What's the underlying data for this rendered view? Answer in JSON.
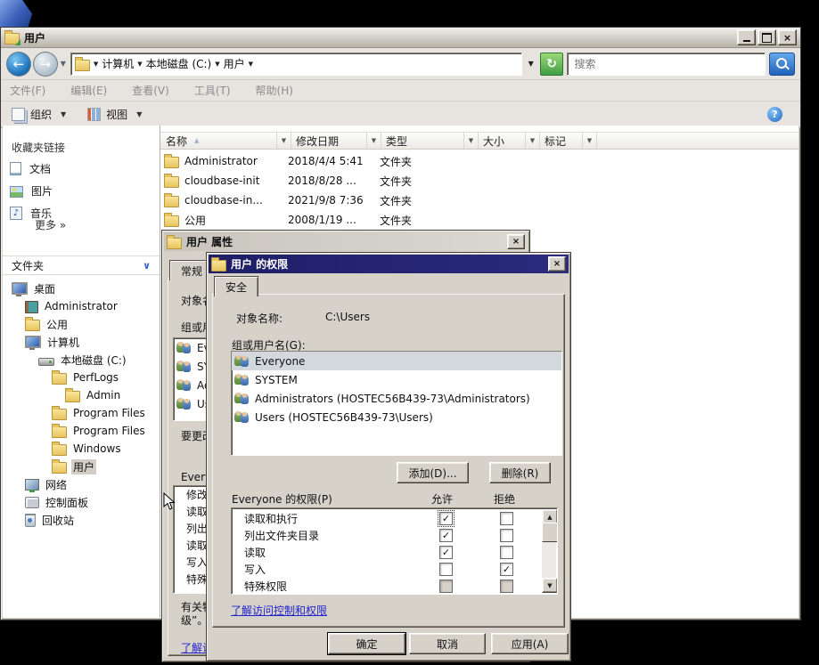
{
  "explorer": {
    "title": "用户",
    "breadcrumbs": [
      "计算机",
      "本地磁盘 (C:)",
      "用户"
    ],
    "search_placeholder": "搜索",
    "menu_items": [
      "文件(F)",
      "编辑(E)",
      "查看(V)",
      "工具(T)",
      "帮助(H)"
    ],
    "toolbar": {
      "organize": "组织",
      "views": "视图"
    },
    "sidebar": {
      "favorites_header": "收藏夹链接",
      "favorites": [
        {
          "label": "文档"
        },
        {
          "label": "图片"
        },
        {
          "label": "音乐"
        }
      ],
      "more_link": "更多  »",
      "folders_header": "文件夹",
      "tree": [
        {
          "label": "桌面",
          "level": 0
        },
        {
          "label": "Administrator",
          "level": 1
        },
        {
          "label": "公用",
          "level": 1
        },
        {
          "label": "计算机",
          "level": 1
        },
        {
          "label": "本地磁盘 (C:)",
          "level": 2
        },
        {
          "label": "PerfLogs",
          "level": 3
        },
        {
          "label": "Admin",
          "level": 4
        },
        {
          "label": "Program Files",
          "level": 3
        },
        {
          "label": "Program Files",
          "level": 3
        },
        {
          "label": "Windows",
          "level": 3
        },
        {
          "label": "用户",
          "level": 3,
          "selected": true
        },
        {
          "label": "网络",
          "level": 1
        },
        {
          "label": "控制面板",
          "level": 1
        },
        {
          "label": "回收站",
          "level": 1
        }
      ]
    },
    "filelist": {
      "columns": [
        "名称",
        "修改日期",
        "类型",
        "大小",
        "标记"
      ],
      "rows": [
        {
          "name": "Administrator",
          "date": "2018/4/4 5:41",
          "type": "文件夹"
        },
        {
          "name": "cloudbase-init",
          "date": "2018/8/28 ...",
          "type": "文件夹"
        },
        {
          "name": "cloudbase-in...",
          "date": "2021/9/8 7:36",
          "type": "文件夹"
        },
        {
          "name": "公用",
          "date": "2008/1/19 ...",
          "type": "文件夹"
        }
      ]
    }
  },
  "props_dialog": {
    "title": "用户 属性",
    "tab": "常规",
    "object_label": "对象名称:",
    "groups_label": "组或用户名(G):",
    "edit_hint": "要更改权限,请单击“编辑”(E)。",
    "perm_header": "Everyone 的权限(P)",
    "perm_rows": [
      "修改",
      "读取和执行",
      "列出文件夹目录",
      "读取",
      "写入",
      "特殊权限"
    ],
    "advanced_hint_1": "有关特殊权限或高级设置,请单击“高",
    "advanced_hint_2": "级”。",
    "link": "了解访问控制和权限"
  },
  "perms_dialog": {
    "title": "用户 的权限",
    "tab": "安全",
    "object_label": "对象名称:",
    "object_value": "C:\\Users",
    "groups_label": "组或用户名(G):",
    "groups": [
      {
        "name": "Everyone",
        "selected": true
      },
      {
        "name": "SYSTEM"
      },
      {
        "name": "Administrators (HOSTEC56B439-73\\Administrators)"
      },
      {
        "name": "Users (HOSTEC56B439-73\\Users)"
      }
    ],
    "add_button": "添加(D)...",
    "remove_button": "删除(R)",
    "perm_header": "Everyone 的权限(P)",
    "allow_header": "允许",
    "deny_header": "拒绝",
    "permissions": [
      {
        "name": "读取和执行",
        "allow": true,
        "deny": false,
        "focused": true
      },
      {
        "name": "列出文件夹目录",
        "allow": true,
        "deny": false
      },
      {
        "name": "读取",
        "allow": true,
        "deny": false
      },
      {
        "name": "写入",
        "allow": false,
        "deny": true
      },
      {
        "name": "特殊权限",
        "allow": false,
        "deny": false,
        "disabled": true
      }
    ],
    "link": "了解访问控制和权限",
    "ok_button": "确定",
    "cancel_button": "取消",
    "apply_button": "应用(A)"
  }
}
